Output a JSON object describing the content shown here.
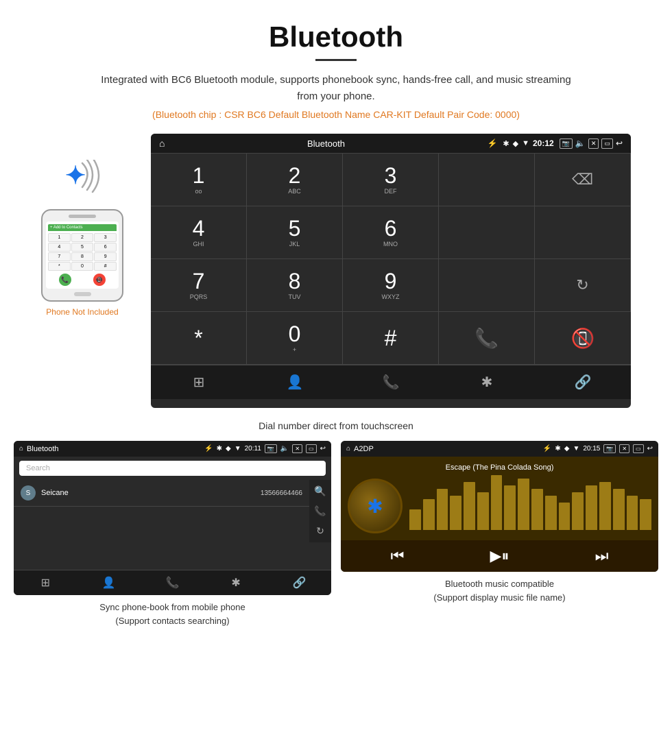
{
  "page": {
    "title": "Bluetooth",
    "divider": true,
    "description": "Integrated with BC6 Bluetooth module, supports phonebook sync, hands-free call, and music streaming from your phone.",
    "specs": "(Bluetooth chip : CSR BC6    Default Bluetooth Name CAR-KIT    Default Pair Code: 0000)"
  },
  "phone_illustration": {
    "not_included_label": "Phone Not Included"
  },
  "main_screen": {
    "statusbar": {
      "home_icon": "⌂",
      "app_name": "Bluetooth",
      "usb_icon": "⚡",
      "bt_icon": "✱",
      "location_icon": "◆",
      "signal_icon": "▼",
      "time": "20:12",
      "camera_icon": "📷",
      "volume_icon": "🔈",
      "close_icon": "✕",
      "window_icon": "▭",
      "back_icon": "↩"
    },
    "dialpad": {
      "rows": [
        [
          "1",
          "oo",
          "2",
          "ABC",
          "3",
          "DEF",
          "",
          "",
          "⌫"
        ],
        [
          "4",
          "GHI",
          "5",
          "JKL",
          "6",
          "MNO",
          "",
          "",
          ""
        ],
        [
          "7",
          "PQRS",
          "8",
          "TUV",
          "9",
          "WXYZ",
          "",
          "",
          "↻"
        ],
        [
          "*",
          "",
          "0",
          "+",
          "#",
          "",
          "📞",
          "",
          "📵"
        ]
      ],
      "keys": [
        {
          "num": "1",
          "sub": "oo"
        },
        {
          "num": "2",
          "sub": "ABC"
        },
        {
          "num": "3",
          "sub": "DEF"
        },
        {
          "num": "",
          "sub": ""
        },
        {
          "num": "⌫",
          "sub": ""
        },
        {
          "num": "4",
          "sub": "GHI"
        },
        {
          "num": "5",
          "sub": "JKL"
        },
        {
          "num": "6",
          "sub": "MNO"
        },
        {
          "num": "",
          "sub": ""
        },
        {
          "num": "",
          "sub": ""
        },
        {
          "num": "7",
          "sub": "PQRS"
        },
        {
          "num": "8",
          "sub": "TUV"
        },
        {
          "num": "9",
          "sub": "WXYZ"
        },
        {
          "num": "",
          "sub": ""
        },
        {
          "num": "↻",
          "sub": ""
        },
        {
          "num": "*",
          "sub": ""
        },
        {
          "num": "0",
          "sub": "+"
        },
        {
          "num": "#",
          "sub": ""
        },
        {
          "num": "📞",
          "sub": ""
        },
        {
          "num": "📵",
          "sub": ""
        }
      ]
    },
    "bottom_nav": [
      "⊞",
      "👤",
      "📞",
      "✱",
      "🔗"
    ]
  },
  "dialpad_caption": "Dial number direct from touchscreen",
  "phonebook_screen": {
    "statusbar": {
      "home_icon": "⌂",
      "app_name": "Bluetooth",
      "usb_icon": "⚡",
      "time": "20:11"
    },
    "search_placeholder": "Search",
    "contacts": [
      {
        "initial": "S",
        "name": "Seicane",
        "number": "13566664466"
      }
    ],
    "bottom_nav": [
      "⊞",
      "👤",
      "📞",
      "✱",
      "🔗"
    ],
    "right_icons": [
      "🔍",
      "📞",
      "↻"
    ]
  },
  "phonebook_caption": "Sync phone-book from mobile phone\n(Support contacts searching)",
  "music_screen": {
    "statusbar": {
      "home_icon": "⌂",
      "app_name": "A2DP",
      "usb_icon": "⚡",
      "time": "20:15"
    },
    "song_title": "Escape (The Pina Colada Song)",
    "eq_bars": [
      30,
      45,
      60,
      50,
      70,
      55,
      80,
      65,
      75,
      60,
      50,
      40,
      55,
      65,
      70,
      60,
      50,
      45
    ],
    "controls": [
      "⏮",
      "▶⏸",
      "⏭"
    ]
  },
  "music_caption": "Bluetooth music compatible\n(Support display music file name)"
}
